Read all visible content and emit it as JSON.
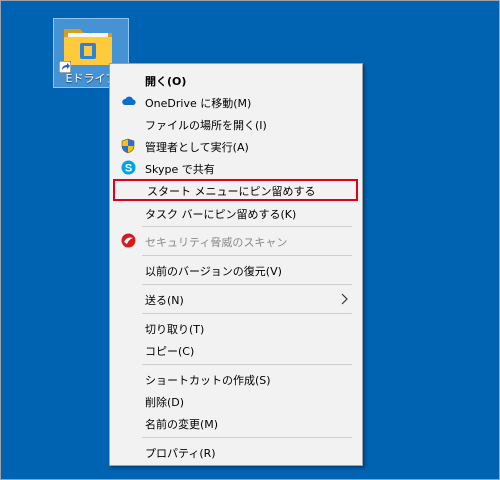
{
  "desktop": {
    "background_color": "#0063b1",
    "icon": {
      "label": "Eドライブ",
      "icon": "folder-icon",
      "overlay": "shortcut-arrow-icon"
    }
  },
  "context_menu": {
    "highlight_color": "#e0001b",
    "items": [
      {
        "label": "開く(O)",
        "bold": true
      },
      {
        "label": "OneDrive に移動(M)",
        "icon": "onedrive-icon"
      },
      {
        "label": "ファイルの場所を開く(I)"
      },
      {
        "label": "管理者として実行(A)",
        "icon": "uac-shield-icon"
      },
      {
        "label": "Skype で共有",
        "icon": "skype-icon"
      },
      {
        "label": "スタート メニューにピン留めする",
        "highlighted": true
      },
      {
        "label": "タスク バーにピン留めする(K)"
      },
      {
        "label": "セキュリティ脅威のスキャン",
        "icon": "trend-micro-icon",
        "disabled": true
      },
      {
        "label": "以前のバージョンの復元(V)"
      },
      {
        "label": "送る(N)",
        "submenu": true
      },
      {
        "label": "切り取り(T)"
      },
      {
        "label": "コピー(C)"
      },
      {
        "label": "ショートカットの作成(S)"
      },
      {
        "label": "削除(D)"
      },
      {
        "label": "名前の変更(M)"
      },
      {
        "label": "プロパティ(R)"
      }
    ]
  }
}
